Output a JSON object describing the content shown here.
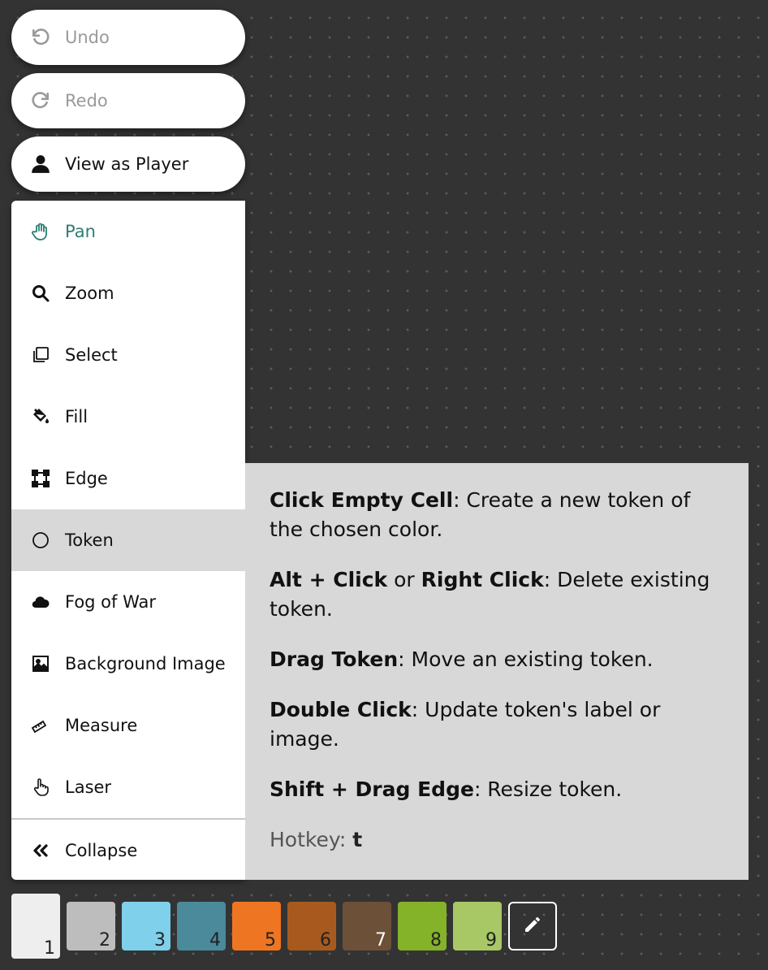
{
  "history": {
    "undo_label": "Undo",
    "redo_label": "Redo"
  },
  "view": {
    "view_as_player_label": "View as Player"
  },
  "tools": {
    "pan": "Pan",
    "zoom": "Zoom",
    "select": "Select",
    "fill": "Fill",
    "edge": "Edge",
    "token": "Token",
    "fog": "Fog of War",
    "background": "Background Image",
    "measure": "Measure",
    "laser": "Laser",
    "collapse": "Collapse"
  },
  "help": {
    "line1_bold": "Click Empty Cell",
    "line1_text": ": Create a new token of the chosen color.",
    "line2_bold_a": "Alt + Click",
    "line2_or": " or ",
    "line2_bold_b": "Right Click",
    "line2_text": ": Delete existing token.",
    "line3_bold": "Drag Token",
    "line3_text": ": Move an existing token.",
    "line4_bold": "Double Click",
    "line4_text": ": Update token's label or image.",
    "line5_bold": "Shift + Drag Edge",
    "line5_text": ": Resize token.",
    "hotkey_label": "Hotkey: ",
    "hotkey_key": "t"
  },
  "palette": [
    {
      "num": "1",
      "color": "#eeeeee",
      "text": "#222222"
    },
    {
      "num": "2",
      "color": "#bdbdbd",
      "text": "#222222"
    },
    {
      "num": "3",
      "color": "#7fd0ea",
      "text": "#222222"
    },
    {
      "num": "4",
      "color": "#4a8a9a",
      "text": "#222222"
    },
    {
      "num": "5",
      "color": "#ee7622",
      "text": "#222222"
    },
    {
      "num": "6",
      "color": "#a85a1e",
      "text": "#222222"
    },
    {
      "num": "7",
      "color": "#6d5038",
      "text": "#ffffff"
    },
    {
      "num": "8",
      "color": "#84b229",
      "text": "#222222"
    },
    {
      "num": "9",
      "color": "#a7c865",
      "text": "#222222"
    }
  ],
  "colors": {
    "accent": "#2e7d73",
    "background": "#333333",
    "selected_tool_bg": "#d8d8d8"
  }
}
